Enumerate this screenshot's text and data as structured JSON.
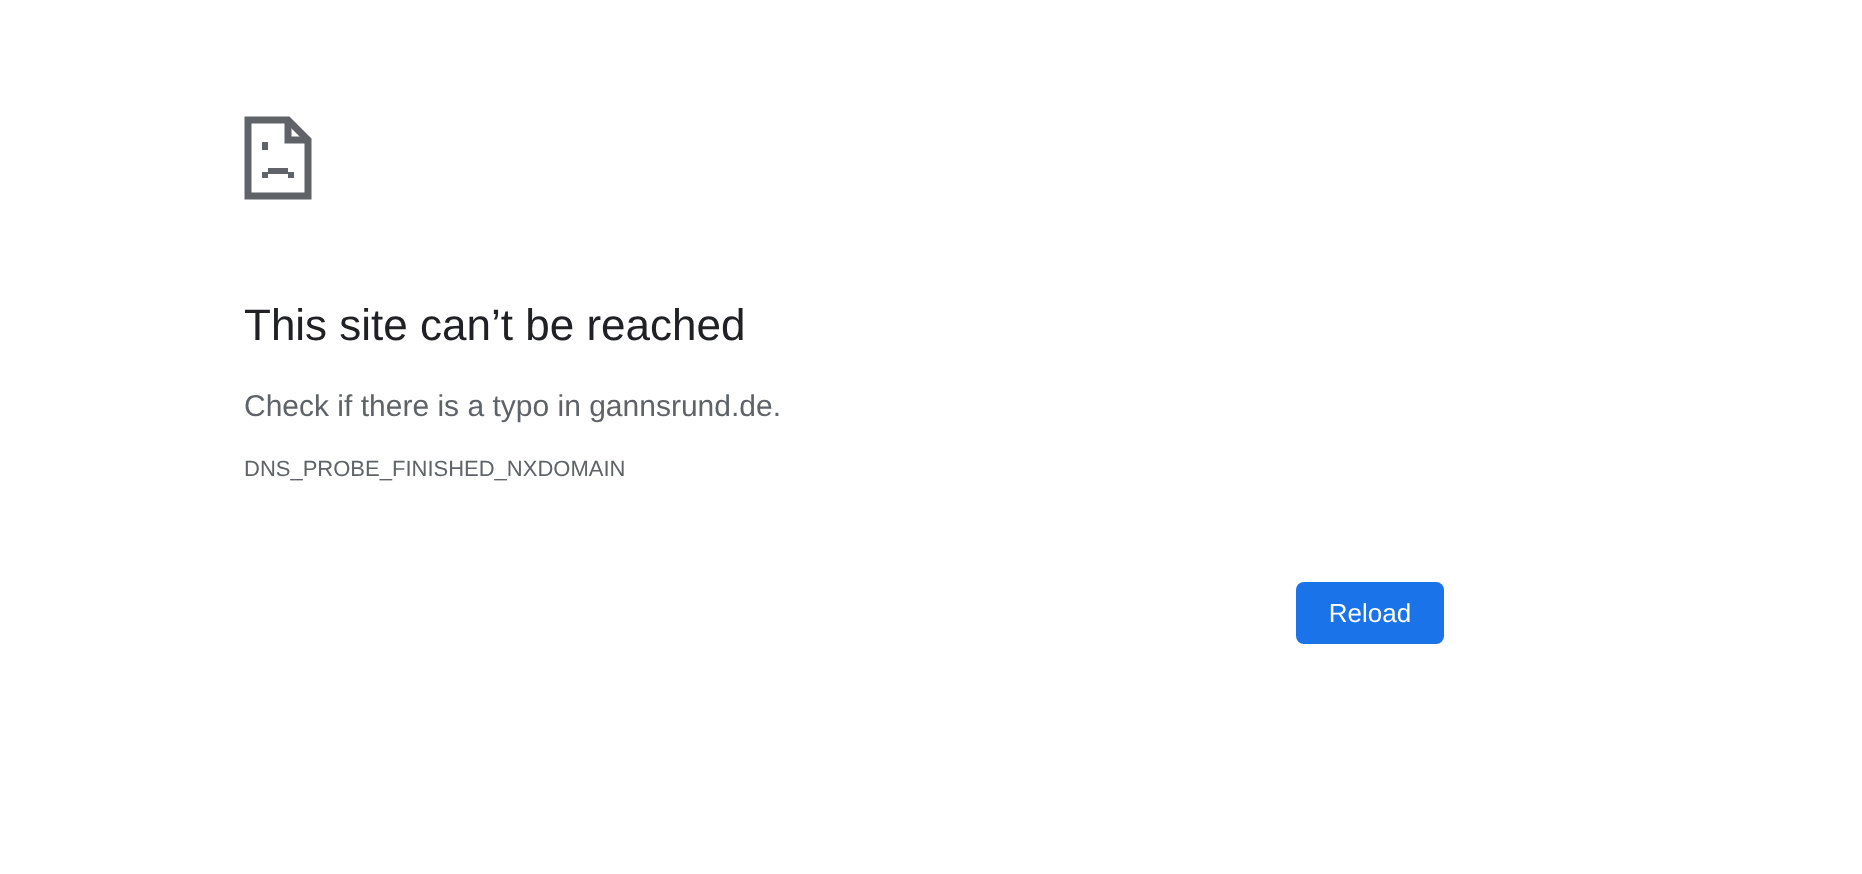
{
  "heading": "This site can’t be reached",
  "message": "Check if there is a typo in gannsrund.de.",
  "error_code": "DNS_PROBE_FINISHED_NXDOMAIN",
  "buttons": [
    {
      "label": "Reload"
    }
  ]
}
